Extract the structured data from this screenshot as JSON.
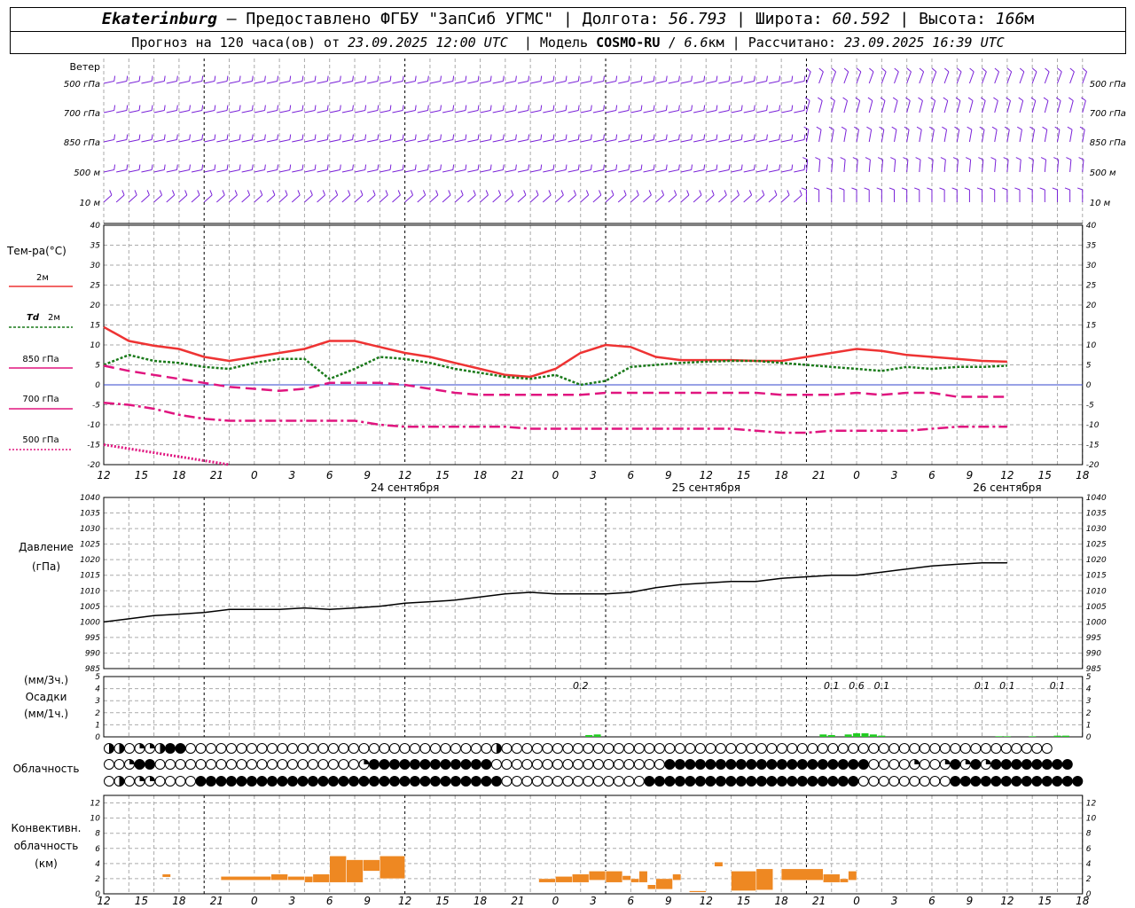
{
  "header": {
    "city": "Ekaterinburg",
    "provider": "– Предоставлено ФГБУ \"ЗапСиб УГМС\"",
    "lon_label": "Долгота:",
    "lon": "56.793",
    "lat_label": "Широта:",
    "lat": "60.592",
    "alt_label": "Высота:",
    "alt": "166",
    "alt_unit": "м",
    "forecast_label": "Прогноз на 120 часа(ов) от",
    "init_time": "23.09.2025 12:00 UTC",
    "model_label": "Модель",
    "model": "COSMO-RU",
    "resolution": "6.6",
    "res_unit": "км",
    "calc_label": "Рассчитано:",
    "calc_time": "23.09.2025 16:39 UTC"
  },
  "labels": {
    "wind": "Ветер",
    "wind_levels": [
      "500 гПа",
      "700 гПа",
      "850 гПа",
      "500 м",
      "10  м"
    ],
    "temp_title": "Тем-ра(°C)",
    "t2m": "2м",
    "td": "Td",
    "td2m": "2м",
    "t850": "850 гПа",
    "t700": "700 гПа",
    "t500": "500 гПа",
    "pressure": "Давление",
    "pressure_unit": "(гПа)",
    "precip_3h": "(мм/3ч.)",
    "precip": "Осадки",
    "precip_1h": "(мм/1ч.)",
    "cloud": "Облачность",
    "conv1": "Конвективн.",
    "conv2": "облачность",
    "conv3": "(км)"
  },
  "chart_data": {
    "type": "line",
    "hours_from_start": [
      0,
      120
    ],
    "x_tick_labels": [
      "12",
      "15",
      "18",
      "21",
      "0",
      "3",
      "6",
      "9",
      "12",
      "15",
      "18",
      "21",
      "0",
      "3",
      "6",
      "9",
      "12",
      "15",
      "18",
      "21",
      "0",
      "3",
      "6",
      "9",
      "12",
      "15",
      "18"
    ],
    "day_labels": [
      {
        "h": 24,
        "text": "24 сентября"
      },
      {
        "h": 48,
        "text": "25 сентября"
      },
      {
        "h": 72,
        "text": "26 сентября"
      }
    ],
    "colors": {
      "t2m": "#ee3333",
      "td": "#1a7a1a",
      "t850": "#e0157f",
      "t700": "#e0157f",
      "t500": "#e0157f",
      "wind": "#7a22d8",
      "precip": "#22cc22",
      "conv": "#ee8822",
      "zero": "#3344cc"
    },
    "temperature": {
      "ylim": [
        -20,
        40
      ],
      "yticks": [
        -20,
        -15,
        -10,
        -5,
        0,
        5,
        10,
        15,
        20,
        25,
        30,
        35,
        40
      ],
      "t2m": [
        [
          0,
          14.5
        ],
        [
          3,
          11
        ],
        [
          6,
          9.8
        ],
        [
          9,
          9
        ],
        [
          12,
          7
        ],
        [
          15,
          6
        ],
        [
          18,
          7
        ],
        [
          21,
          8
        ],
        [
          24,
          9
        ],
        [
          27,
          11
        ],
        [
          30,
          11
        ],
        [
          33,
          9.5
        ],
        [
          36,
          8
        ],
        [
          39,
          7
        ],
        [
          42,
          5.5
        ],
        [
          45,
          4
        ],
        [
          48,
          2.5
        ],
        [
          51,
          2
        ],
        [
          54,
          4
        ],
        [
          57,
          8
        ],
        [
          60,
          10
        ],
        [
          63,
          9.5
        ],
        [
          66,
          7
        ],
        [
          69,
          6.2
        ],
        [
          72,
          6.2
        ],
        [
          75,
          6.2
        ],
        [
          78,
          6
        ],
        [
          81,
          6
        ],
        [
          84,
          7
        ],
        [
          87,
          8
        ],
        [
          90,
          9
        ],
        [
          93,
          8.5
        ],
        [
          96,
          7.5
        ],
        [
          99,
          7
        ],
        [
          102,
          6.5
        ],
        [
          105,
          6
        ],
        [
          108,
          5.8
        ]
      ],
      "td2m": [
        [
          0,
          5
        ],
        [
          3,
          7.5
        ],
        [
          6,
          6
        ],
        [
          9,
          5.5
        ],
        [
          12,
          4.5
        ],
        [
          15,
          4
        ],
        [
          18,
          5.5
        ],
        [
          21,
          6.5
        ],
        [
          24,
          6.5
        ],
        [
          27,
          1.5
        ],
        [
          30,
          4
        ],
        [
          33,
          7
        ],
        [
          36,
          6.5
        ],
        [
          39,
          5.5
        ],
        [
          42,
          4
        ],
        [
          45,
          3
        ],
        [
          48,
          2
        ],
        [
          51,
          1.5
        ],
        [
          54,
          2.5
        ],
        [
          57,
          0
        ],
        [
          60,
          1
        ],
        [
          63,
          4.5
        ],
        [
          66,
          5
        ],
        [
          69,
          5.5
        ],
        [
          72,
          5.8
        ],
        [
          75,
          6
        ],
        [
          78,
          6
        ],
        [
          81,
          5.5
        ],
        [
          84,
          5
        ],
        [
          87,
          4.5
        ],
        [
          90,
          4
        ],
        [
          93,
          3.5
        ],
        [
          96,
          4.5
        ],
        [
          99,
          4
        ],
        [
          102,
          4.5
        ],
        [
          105,
          4.5
        ],
        [
          108,
          4.8
        ]
      ],
      "t850": [
        [
          0,
          4.8
        ],
        [
          3,
          3.5
        ],
        [
          6,
          2.5
        ],
        [
          9,
          1.5
        ],
        [
          12,
          0.5
        ],
        [
          15,
          -0.5
        ],
        [
          18,
          -1
        ],
        [
          21,
          -1.5
        ],
        [
          24,
          -1
        ],
        [
          27,
          0.5
        ],
        [
          30,
          0.5
        ],
        [
          33,
          0.5
        ],
        [
          36,
          0
        ],
        [
          39,
          -1
        ],
        [
          42,
          -2
        ],
        [
          45,
          -2.5
        ],
        [
          48,
          -2.5
        ],
        [
          51,
          -2.5
        ],
        [
          54,
          -2.5
        ],
        [
          57,
          -2.5
        ],
        [
          60,
          -2
        ],
        [
          63,
          -2
        ],
        [
          66,
          -2
        ],
        [
          69,
          -2
        ],
        [
          72,
          -2
        ],
        [
          75,
          -2
        ],
        [
          78,
          -2
        ],
        [
          81,
          -2.5
        ],
        [
          84,
          -2.5
        ],
        [
          87,
          -2.5
        ],
        [
          90,
          -2
        ],
        [
          93,
          -2.5
        ],
        [
          96,
          -2
        ],
        [
          99,
          -2
        ],
        [
          102,
          -3
        ],
        [
          105,
          -3
        ],
        [
          108,
          -3
        ]
      ],
      "t700": [
        [
          0,
          -4.5
        ],
        [
          3,
          -5
        ],
        [
          6,
          -6
        ],
        [
          9,
          -7.5
        ],
        [
          12,
          -8.5
        ],
        [
          15,
          -9
        ],
        [
          18,
          -9
        ],
        [
          21,
          -9
        ],
        [
          24,
          -9
        ],
        [
          27,
          -9
        ],
        [
          30,
          -9
        ],
        [
          33,
          -10
        ],
        [
          36,
          -10.5
        ],
        [
          39,
          -10.5
        ],
        [
          42,
          -10.5
        ],
        [
          45,
          -10.5
        ],
        [
          48,
          -10.5
        ],
        [
          51,
          -11
        ],
        [
          54,
          -11
        ],
        [
          57,
          -11
        ],
        [
          60,
          -11
        ],
        [
          63,
          -11
        ],
        [
          66,
          -11
        ],
        [
          69,
          -11
        ],
        [
          72,
          -11
        ],
        [
          75,
          -11
        ],
        [
          78,
          -11.5
        ],
        [
          81,
          -12
        ],
        [
          84,
          -12
        ],
        [
          87,
          -11.5
        ],
        [
          90,
          -11.5
        ],
        [
          93,
          -11.5
        ],
        [
          96,
          -11.5
        ],
        [
          99,
          -11
        ],
        [
          102,
          -10.5
        ],
        [
          105,
          -10.5
        ],
        [
          108,
          -10.5
        ]
      ],
      "t500": [
        [
          0,
          -15
        ],
        [
          3,
          -16
        ],
        [
          6,
          -17
        ],
        [
          9,
          -18
        ],
        [
          12,
          -19
        ],
        [
          15,
          -20
        ]
      ]
    },
    "pressure": {
      "ylim": [
        985,
        1040
      ],
      "yticks": [
        985,
        990,
        995,
        1000,
        1005,
        1010,
        1015,
        1020,
        1025,
        1030,
        1035,
        1040
      ],
      "values": [
        [
          0,
          1000
        ],
        [
          3,
          1001
        ],
        [
          6,
          1002
        ],
        [
          9,
          1002.5
        ],
        [
          12,
          1003
        ],
        [
          15,
          1004
        ],
        [
          18,
          1004
        ],
        [
          21,
          1004
        ],
        [
          24,
          1004.5
        ],
        [
          27,
          1004
        ],
        [
          30,
          1004.5
        ],
        [
          33,
          1005
        ],
        [
          36,
          1006
        ],
        [
          39,
          1006.5
        ],
        [
          42,
          1007
        ],
        [
          45,
          1008
        ],
        [
          48,
          1009
        ],
        [
          51,
          1009.5
        ],
        [
          54,
          1009
        ],
        [
          57,
          1009
        ],
        [
          60,
          1009
        ],
        [
          63,
          1009.5
        ],
        [
          66,
          1011
        ],
        [
          69,
          1012
        ],
        [
          72,
          1012.5
        ],
        [
          75,
          1013
        ],
        [
          78,
          1013
        ],
        [
          81,
          1014
        ],
        [
          84,
          1014.5
        ],
        [
          87,
          1015
        ],
        [
          90,
          1015
        ],
        [
          93,
          1016
        ],
        [
          96,
          1017
        ],
        [
          99,
          1018
        ],
        [
          102,
          1018.5
        ],
        [
          105,
          1019
        ],
        [
          108,
          1019
        ]
      ]
    },
    "precipitation": {
      "ylim": [
        0,
        5
      ],
      "yticks": [
        0,
        1,
        2,
        3,
        4,
        5
      ],
      "labels_3h": [
        {
          "h": 57,
          "text": "0.2"
        },
        {
          "h": 87,
          "text": "0.1"
        },
        {
          "h": 90,
          "text": "0.6"
        },
        {
          "h": 93,
          "text": "0.1"
        },
        {
          "h": 105,
          "text": "0.1"
        },
        {
          "h": 108,
          "text": "0.1"
        },
        {
          "h": 114,
          "text": "0.1"
        }
      ],
      "bars_1h": [
        [
          58,
          0.15
        ],
        [
          59,
          0.2
        ],
        [
          86,
          0.2
        ],
        [
          87,
          0.15
        ],
        [
          89,
          0.2
        ],
        [
          90,
          0.3
        ],
        [
          91,
          0.3
        ],
        [
          92,
          0.2
        ],
        [
          93,
          0.1
        ],
        [
          107,
          0.05
        ],
        [
          108,
          0.05
        ],
        [
          111,
          0.05
        ],
        [
          114,
          0.1
        ],
        [
          115,
          0.1
        ]
      ]
    },
    "cloud_rows": [
      "HHOQQHFFOOOOOOOOOOOOOOOOOOOOOOOOOOOOOOHOOOOOOOOOOOOOOOOOOOOOOOOOOOOOOOOOOOOOOOOOOOOOOOOOOOOOO",
      "OOQFFOOOOOOOOOOOOOOOOOOOOQFFFFFFFFFFFFOOOOOOOOOOOOOOOOOFFFFFFFFFFFFFFFFFFFFOOOOQOOQFQFQFFFFFFFF",
      "OHOQQOOOOFFFFFFFFFFFFFFFFFFFFFFFFFFFFFFOOOOOOOOOOOOOOFFFFFFFFFFFFFFFFFFFFFOOOOOOOOOFFFFFFFFFFFFF"
    ],
    "convective": {
      "ylim": [
        0,
        13
      ],
      "yticks": [
        0,
        2,
        4,
        6,
        8,
        10,
        12
      ],
      "segments": [
        [
          7,
          8,
          2.2,
          2.6
        ],
        [
          14,
          20,
          1.8,
          2.3
        ],
        [
          20,
          22,
          1.8,
          2.6
        ],
        [
          22,
          24,
          1.8,
          2.3
        ],
        [
          24,
          25,
          1.5,
          2.3
        ],
        [
          25,
          27,
          1.5,
          2.6
        ],
        [
          27,
          29,
          1.5,
          5
        ],
        [
          29,
          31,
          1.5,
          4.5
        ],
        [
          31,
          33,
          3,
          4.5
        ],
        [
          33,
          36,
          2,
          5
        ],
        [
          52,
          54,
          1.5,
          2
        ],
        [
          54,
          56,
          1.5,
          2.3
        ],
        [
          56,
          58,
          1.5,
          2.6
        ],
        [
          58,
          60,
          1.8,
          3
        ],
        [
          60,
          62,
          1.5,
          3
        ],
        [
          62,
          63,
          1.8,
          2.4
        ],
        [
          63,
          64,
          1.5,
          2
        ],
        [
          64,
          65,
          1.5,
          3
        ],
        [
          65,
          66,
          0.6,
          1.2
        ],
        [
          66,
          68,
          0.6,
          2
        ],
        [
          68,
          69,
          1.8,
          2.6
        ],
        [
          70,
          72,
          0.2,
          0.4
        ],
        [
          73,
          74,
          3.6,
          4.2
        ],
        [
          75,
          78,
          0.4,
          3
        ],
        [
          78,
          80,
          0.5,
          3.3
        ],
        [
          81,
          86,
          1.8,
          3.3
        ],
        [
          86,
          88,
          1.5,
          2.6
        ],
        [
          88,
          89,
          1.5,
          2
        ],
        [
          89,
          90,
          1.8,
          3
        ]
      ]
    }
  }
}
